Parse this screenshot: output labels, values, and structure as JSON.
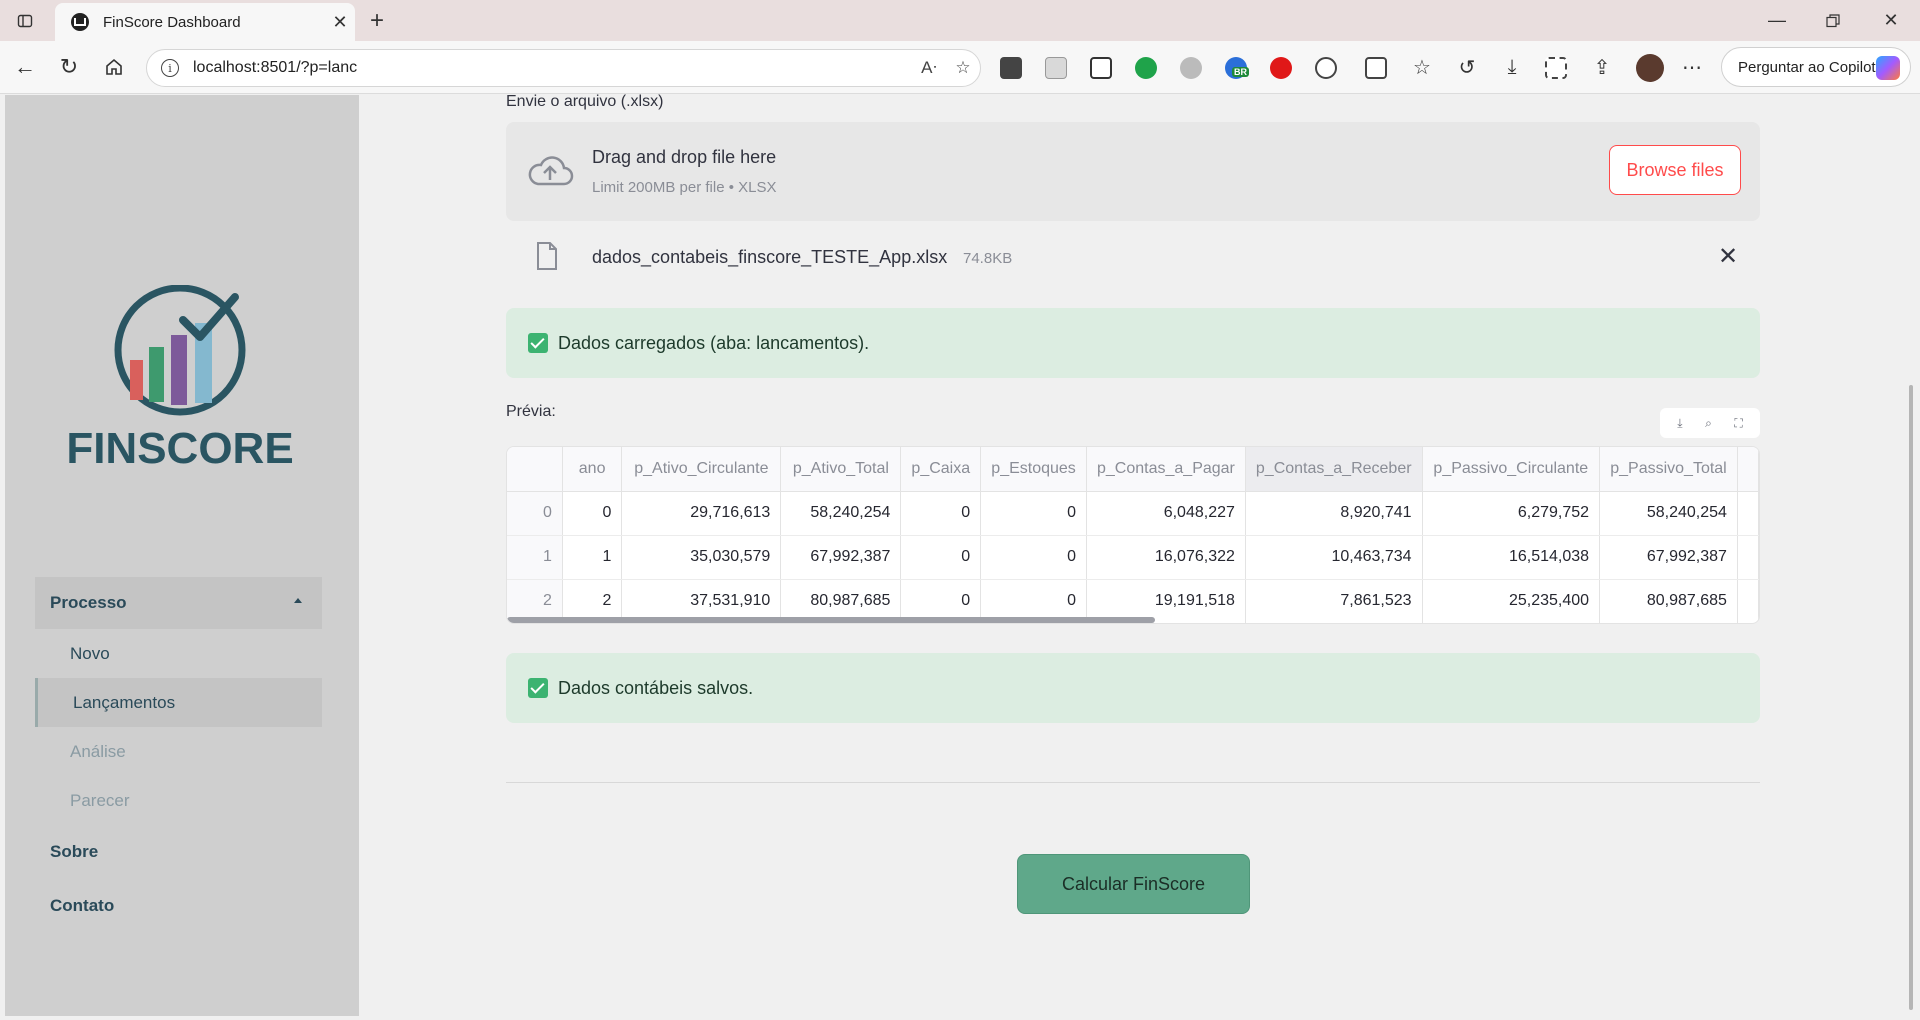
{
  "browser": {
    "tab_title": "FinScore Dashboard",
    "url": "localhost:8501/?p=lanc",
    "copilot_label": "Perguntar ao Copilot",
    "extension_badge": "BR"
  },
  "sidebar": {
    "logo_text": "FINSCORE",
    "group_label": "Processo",
    "subitems": [
      {
        "label": "Novo",
        "state": "normal"
      },
      {
        "label": "Lançamentos",
        "state": "active"
      },
      {
        "label": "Análise",
        "state": "disabled"
      },
      {
        "label": "Parecer",
        "state": "disabled"
      }
    ],
    "items": [
      {
        "label": "Sobre"
      },
      {
        "label": "Contato"
      }
    ]
  },
  "upload": {
    "label": "Envie o arquivo (.xlsx)",
    "drop_title": "Drag and drop file here",
    "drop_hint": "Limit 200MB per file • XLSX",
    "browse_label": "Browse files",
    "file_name": "dados_contabeis_finscore_TESTE_App.xlsx",
    "file_size": "74.8KB"
  },
  "alerts": {
    "loaded": "Dados carregados (aba: lancamentos).",
    "saved": "Dados contábeis salvos."
  },
  "preview": {
    "label": "Prévia:",
    "columns": [
      "",
      "ano",
      "p_Ativo_Circulante",
      "p_Ativo_Total",
      "p_Caixa",
      "p_Estoques",
      "p_Contas_a_Pagar",
      "p_Contas_a_Receber",
      "p_Passivo_Circulante",
      "p_Passivo_Total"
    ],
    "rows": [
      [
        "0",
        "0",
        "29,716,613",
        "58,240,254",
        "0",
        "0",
        "6,048,227",
        "8,920,741",
        "6,279,752",
        "58,240,254"
      ],
      [
        "1",
        "1",
        "35,030,579",
        "67,992,387",
        "0",
        "0",
        "16,076,322",
        "10,463,734",
        "16,514,038",
        "67,992,387"
      ],
      [
        "2",
        "2",
        "37,531,910",
        "80,987,685",
        "0",
        "0",
        "19,191,518",
        "7,861,523",
        "25,235,400",
        "80,987,685"
      ]
    ]
  },
  "actions": {
    "calculate_label": "Calcular FinScore"
  },
  "colors": {
    "primary_red": "#ff4b4b",
    "success_bg": "#dcede1",
    "brand_teal": "#2a4a59",
    "button_green": "#5fa88a"
  }
}
